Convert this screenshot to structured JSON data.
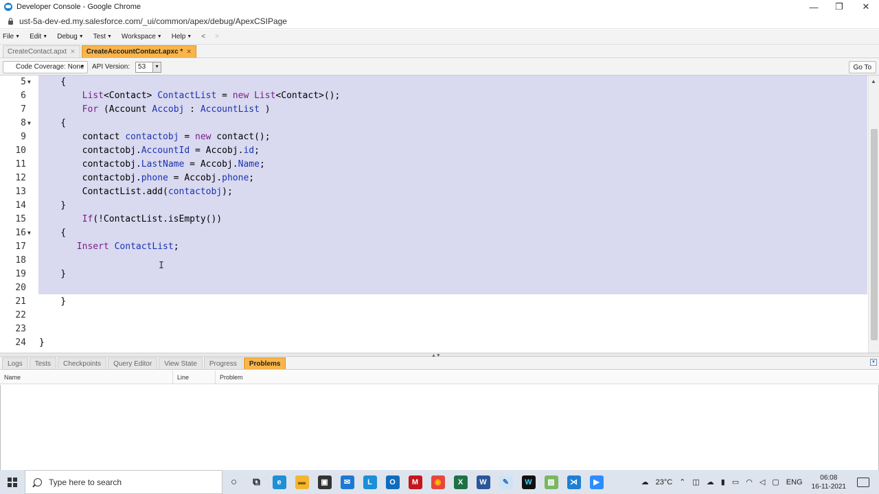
{
  "window": {
    "title": "Developer Console - Google Chrome",
    "minimize": "—",
    "maximize": "❐",
    "close": "✕"
  },
  "browser": {
    "url": "ust-5a-dev-ed.my.salesforce.com/_ui/common/apex/debug/ApexCSIPage"
  },
  "menu": {
    "items": [
      "File",
      "Edit",
      "Debug",
      "Test",
      "Workspace",
      "Help"
    ],
    "back": "<",
    "forward": ">"
  },
  "file_tabs": [
    {
      "label": "CreateContact.apxt",
      "active": false
    },
    {
      "label": "CreateAccountContact.apxc *",
      "active": true
    }
  ],
  "toolbar": {
    "coverage": "Code Coverage: None",
    "api_label": "API Version:",
    "api_value": "53",
    "goto": "Go To"
  },
  "editor": {
    "lines": [
      {
        "n": "5",
        "fold": true,
        "html": "    {"
      },
      {
        "n": "6",
        "fold": false,
        "html": "        <span class=\"kw\">List</span>&lt;Contact&gt; <span class=\"vr\">ContactList</span> = <span class=\"kw\">new</span> <span class=\"kw\">List</span>&lt;Contact&gt;();"
      },
      {
        "n": "7",
        "fold": false,
        "html": "        <span class=\"kw\">For</span> (Account <span class=\"vr\">Accobj</span> : <span class=\"vr\">AccountList</span> )"
      },
      {
        "n": "8",
        "fold": true,
        "html": "    {"
      },
      {
        "n": "9",
        "fold": false,
        "html": "        contact <span class=\"vr\">contactobj</span> = <span class=\"kw\">new</span> contact();"
      },
      {
        "n": "10",
        "fold": false,
        "html": "        contactobj.<span class=\"vr\">AccountId</span> = Accobj.<span class=\"vr\">id</span>;"
      },
      {
        "n": "11",
        "fold": false,
        "html": "        contactobj.<span class=\"vr\">LastName</span> = Accobj.<span class=\"vr\">Name</span>;"
      },
      {
        "n": "12",
        "fold": false,
        "html": "        contactobj.<span class=\"vr\">phone</span> = Accobj.<span class=\"vr\">phone</span>;"
      },
      {
        "n": "13",
        "fold": false,
        "html": "        ContactList.add(<span class=\"vr\">contactobj</span>);"
      },
      {
        "n": "14",
        "fold": false,
        "html": "    }"
      },
      {
        "n": "15",
        "fold": false,
        "html": "        <span class=\"kw\">If</span>(!ContactList.isEmpty())"
      },
      {
        "n": "16",
        "fold": true,
        "html": "    {"
      },
      {
        "n": "17",
        "fold": false,
        "html": "       <span class=\"kw\">Insert</span> <span class=\"vr\">ContactList</span>;"
      },
      {
        "n": "18",
        "fold": false,
        "html": ""
      },
      {
        "n": "19",
        "fold": false,
        "html": "    }"
      },
      {
        "n": "20",
        "fold": false,
        "html": ""
      },
      {
        "n": "21",
        "fold": false,
        "html": "    }"
      },
      {
        "n": "22",
        "fold": false,
        "html": ""
      },
      {
        "n": "23",
        "fold": false,
        "html": ""
      },
      {
        "n": "24",
        "fold": false,
        "html": "}"
      }
    ]
  },
  "bottom_tabs": [
    {
      "label": "Logs",
      "active": false
    },
    {
      "label": "Tests",
      "active": false
    },
    {
      "label": "Checkpoints",
      "active": false
    },
    {
      "label": "Query Editor",
      "active": false
    },
    {
      "label": "View State",
      "active": false
    },
    {
      "label": "Progress",
      "active": false
    },
    {
      "label": "Problems",
      "active": true
    }
  ],
  "problems": {
    "columns": [
      "Name",
      "Line",
      "Problem"
    ]
  },
  "taskbar": {
    "search_placeholder": "Type here to search",
    "apps": [
      {
        "name": "cortana-icon",
        "glyph": "○",
        "bg": "transparent",
        "fg": "#222"
      },
      {
        "name": "task-view-icon",
        "glyph": "⧉",
        "bg": "transparent",
        "fg": "#222"
      },
      {
        "name": "edge-icon",
        "glyph": "e",
        "bg": "#1f8fd6",
        "fg": "#fff"
      },
      {
        "name": "file-explorer-icon",
        "glyph": "▬",
        "bg": "#f2b630",
        "fg": "#8a5a00"
      },
      {
        "name": "store-icon",
        "glyph": "▣",
        "bg": "#333",
        "fg": "#fff"
      },
      {
        "name": "mail-icon",
        "glyph": "✉",
        "bg": "#1f78d1",
        "fg": "#fff"
      },
      {
        "name": "l-app-icon",
        "glyph": "L",
        "bg": "#1b8fd8",
        "fg": "#fff"
      },
      {
        "name": "outlook-icon",
        "glyph": "O",
        "bg": "#0f6cbd",
        "fg": "#fff"
      },
      {
        "name": "mcafee-icon",
        "glyph": "M",
        "bg": "#c4161c",
        "fg": "#fff"
      },
      {
        "name": "chrome-icon",
        "glyph": "◉",
        "bg": "#e8453c",
        "fg": "#fbbc04"
      },
      {
        "name": "excel-icon",
        "glyph": "X",
        "bg": "#1e7145",
        "fg": "#fff"
      },
      {
        "name": "word-icon",
        "glyph": "W",
        "bg": "#2b579a",
        "fg": "#fff"
      },
      {
        "name": "paint-icon",
        "glyph": "✎",
        "bg": "#cfe3f5",
        "fg": "#2b6cb0"
      },
      {
        "name": "webex-icon",
        "glyph": "W",
        "bg": "#111",
        "fg": "#3fd0ff"
      },
      {
        "name": "photos-icon",
        "glyph": "▨",
        "bg": "#7bb661",
        "fg": "#fff"
      },
      {
        "name": "vscode-icon",
        "glyph": "⋊",
        "bg": "#1f7fd1",
        "fg": "#fff"
      },
      {
        "name": "zoom-icon",
        "glyph": "▶",
        "bg": "#2d8cff",
        "fg": "#fff"
      }
    ],
    "weather": "23°C",
    "language": "ENG",
    "time": "06:08",
    "date": "16-11-2021"
  }
}
